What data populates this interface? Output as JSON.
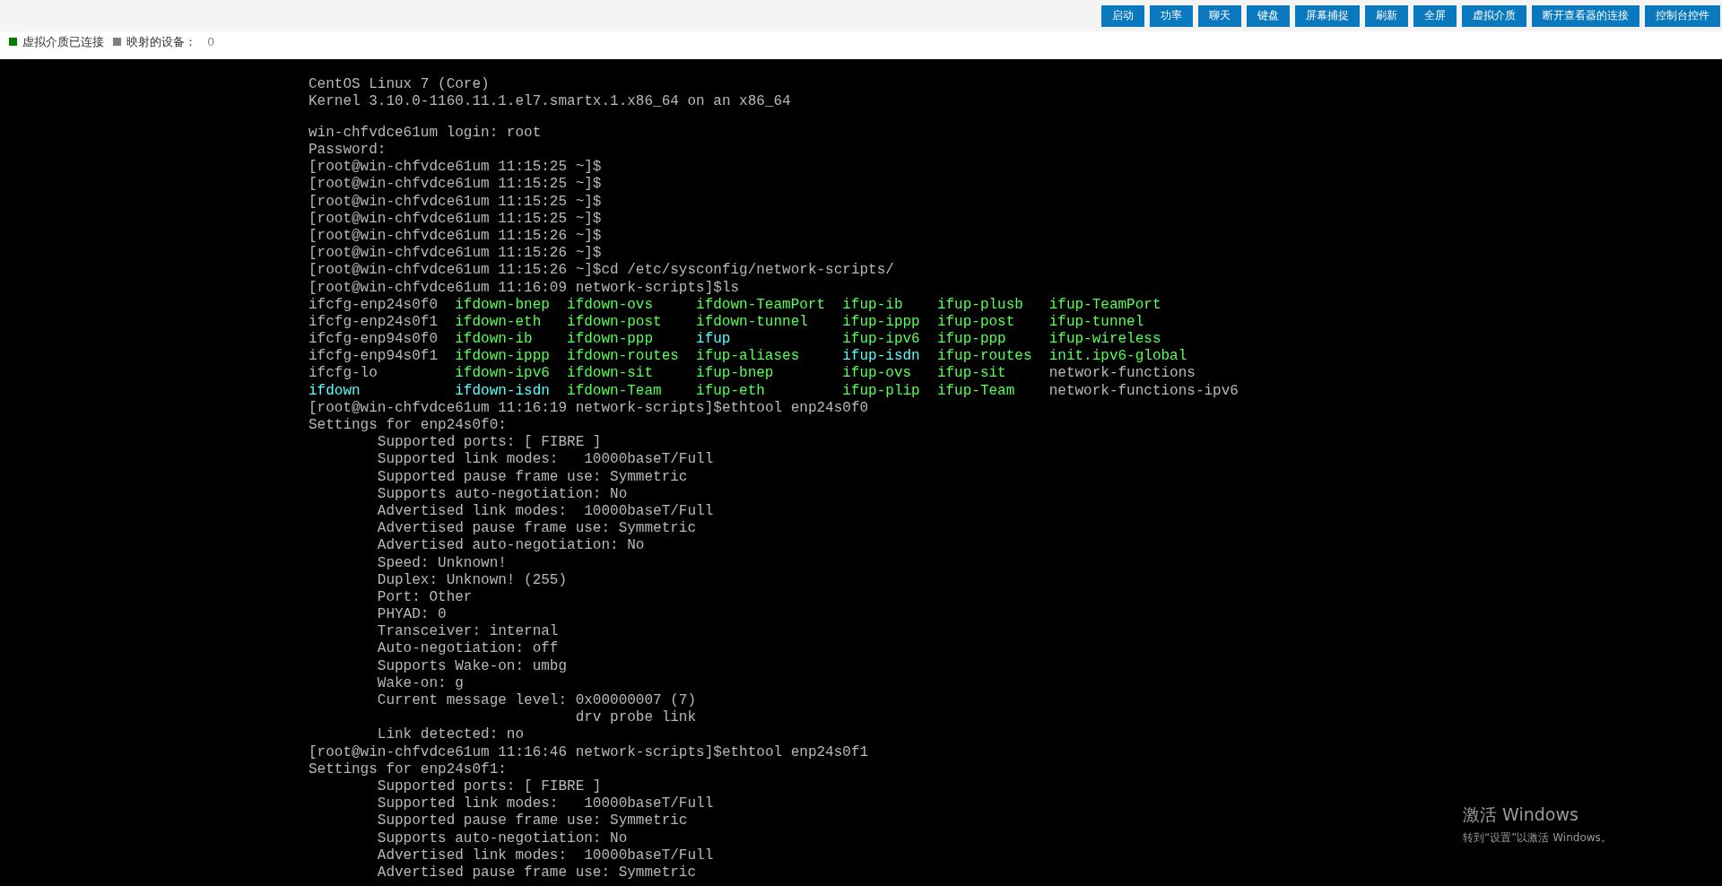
{
  "toolbar": {
    "buttons": [
      "启动",
      "功率",
      "聊天",
      "键盘",
      "屏幕捕捉",
      "刷新",
      "全屏",
      "虚拟介质",
      "断开查看器的连接",
      "控制台控件"
    ]
  },
  "status": [
    {
      "label": "虚拟介质已连接",
      "color": "#008000"
    },
    {
      "label": "映射的设备：",
      "color": "#808080",
      "value": "0"
    }
  ],
  "terminal": {
    "lines": [
      {
        "kind": "line",
        "text": "CentOS Linux 7 (Core)"
      },
      {
        "kind": "line",
        "text": "Kernel 3.10.0-1160.11.1.el7.smartx.1.x86_64 on an x86_64"
      },
      {
        "kind": "line",
        "gap_before": true,
        "text": "win-chfvdce61um login: root"
      },
      {
        "kind": "line",
        "text": "Password:"
      },
      {
        "kind": "line",
        "text": "[root@win-chfvdce61um 11:15:25 ~]$"
      },
      {
        "kind": "line",
        "text": "[root@win-chfvdce61um 11:15:25 ~]$"
      },
      {
        "kind": "line",
        "text": "[root@win-chfvdce61um 11:15:25 ~]$"
      },
      {
        "kind": "line",
        "text": "[root@win-chfvdce61um 11:15:25 ~]$"
      },
      {
        "kind": "line",
        "text": "[root@win-chfvdce61um 11:15:26 ~]$"
      },
      {
        "kind": "line",
        "text": "[root@win-chfvdce61um 11:15:26 ~]$"
      },
      {
        "kind": "line",
        "text": "[root@win-chfvdce61um 11:15:26 ~]$cd /etc/sysconfig/network-scripts/"
      },
      {
        "kind": "line",
        "text": "[root@win-chfvdce61um 11:16:09 network-scripts]$ls"
      },
      {
        "kind": "ls_row",
        "entries": [
          {
            "name": "ifcfg-enp24s0f0",
            "kind": "file"
          },
          {
            "name": "ifdown-bnep",
            "kind": "exec"
          },
          {
            "name": "ifdown-ovs",
            "kind": "exec"
          },
          {
            "name": "ifdown-TeamPort",
            "kind": "exec"
          },
          {
            "name": "ifup-ib",
            "kind": "exec"
          },
          {
            "name": "ifup-plusb",
            "kind": "exec"
          },
          {
            "name": "ifup-TeamPort",
            "kind": "exec"
          }
        ]
      },
      {
        "kind": "ls_row",
        "entries": [
          {
            "name": "ifcfg-enp24s0f1",
            "kind": "file"
          },
          {
            "name": "ifdown-eth",
            "kind": "exec"
          },
          {
            "name": "ifdown-post",
            "kind": "exec"
          },
          {
            "name": "ifdown-tunnel",
            "kind": "exec"
          },
          {
            "name": "ifup-ippp",
            "kind": "exec"
          },
          {
            "name": "ifup-post",
            "kind": "exec"
          },
          {
            "name": "ifup-tunnel",
            "kind": "exec"
          }
        ]
      },
      {
        "kind": "ls_row",
        "entries": [
          {
            "name": "ifcfg-enp94s0f0",
            "kind": "file"
          },
          {
            "name": "ifdown-ib",
            "kind": "exec"
          },
          {
            "name": "ifdown-ppp",
            "kind": "exec"
          },
          {
            "name": "ifup",
            "kind": "link"
          },
          {
            "name": "ifup-ipv6",
            "kind": "exec"
          },
          {
            "name": "ifup-ppp",
            "kind": "exec"
          },
          {
            "name": "ifup-wireless",
            "kind": "exec"
          }
        ]
      },
      {
        "kind": "ls_row",
        "entries": [
          {
            "name": "ifcfg-enp94s0f1",
            "kind": "file"
          },
          {
            "name": "ifdown-ippp",
            "kind": "exec"
          },
          {
            "name": "ifdown-routes",
            "kind": "exec"
          },
          {
            "name": "ifup-aliases",
            "kind": "exec"
          },
          {
            "name": "ifup-isdn",
            "kind": "link"
          },
          {
            "name": "ifup-routes",
            "kind": "exec"
          },
          {
            "name": "init.ipv6-global",
            "kind": "exec"
          }
        ]
      },
      {
        "kind": "ls_row",
        "entries": [
          {
            "name": "ifcfg-lo",
            "kind": "file"
          },
          {
            "name": "ifdown-ipv6",
            "kind": "exec"
          },
          {
            "name": "ifdown-sit",
            "kind": "exec"
          },
          {
            "name": "ifup-bnep",
            "kind": "exec"
          },
          {
            "name": "ifup-ovs",
            "kind": "exec"
          },
          {
            "name": "ifup-sit",
            "kind": "exec"
          },
          {
            "name": "network-functions",
            "kind": "file"
          }
        ]
      },
      {
        "kind": "ls_row",
        "entries": [
          {
            "name": "ifdown",
            "kind": "link"
          },
          {
            "name": "ifdown-isdn",
            "kind": "link"
          },
          {
            "name": "ifdown-Team",
            "kind": "exec"
          },
          {
            "name": "ifup-eth",
            "kind": "exec"
          },
          {
            "name": "ifup-plip",
            "kind": "exec"
          },
          {
            "name": "ifup-Team",
            "kind": "exec"
          },
          {
            "name": "network-functions-ipv6",
            "kind": "file"
          }
        ]
      },
      {
        "kind": "line",
        "text": "[root@win-chfvdce61um 11:16:19 network-scripts]$ethtool enp24s0f0"
      },
      {
        "kind": "line",
        "text": "Settings for enp24s0f0:"
      },
      {
        "kind": "detail",
        "text": "Supported ports: [ FIBRE ]"
      },
      {
        "kind": "detail",
        "text": "Supported link modes:   10000baseT/Full"
      },
      {
        "kind": "detail",
        "text": "Supported pause frame use: Symmetric"
      },
      {
        "kind": "detail",
        "text": "Supports auto-negotiation: No"
      },
      {
        "kind": "detail",
        "text": "Advertised link modes:  10000baseT/Full"
      },
      {
        "kind": "detail",
        "text": "Advertised pause frame use: Symmetric"
      },
      {
        "kind": "detail",
        "text": "Advertised auto-negotiation: No"
      },
      {
        "kind": "detail",
        "text": "Speed: Unknown!"
      },
      {
        "kind": "detail",
        "text": "Duplex: Unknown! (255)"
      },
      {
        "kind": "detail",
        "text": "Port: Other"
      },
      {
        "kind": "detail",
        "text": "PHYAD: 0"
      },
      {
        "kind": "detail",
        "text": "Transceiver: internal"
      },
      {
        "kind": "detail",
        "text": "Auto-negotiation: off"
      },
      {
        "kind": "detail",
        "text": "Supports Wake-on: umbg"
      },
      {
        "kind": "detail",
        "text": "Wake-on: g"
      },
      {
        "kind": "detail",
        "text": "Current message level: 0x00000007 (7)"
      },
      {
        "kind": "continuation",
        "text": "drv probe link"
      },
      {
        "kind": "detail",
        "text": "Link detected: no"
      },
      {
        "kind": "line",
        "text": "[root@win-chfvdce61um 11:16:46 network-scripts]$ethtool enp24s0f1"
      },
      {
        "kind": "line",
        "text": "Settings for enp24s0f1:"
      },
      {
        "kind": "detail",
        "text": "Supported ports: [ FIBRE ]"
      },
      {
        "kind": "detail",
        "text": "Supported link modes:   10000baseT/Full"
      },
      {
        "kind": "detail",
        "text": "Supported pause frame use: Symmetric"
      },
      {
        "kind": "detail",
        "text": "Supports auto-negotiation: No"
      },
      {
        "kind": "detail",
        "text": "Advertised link modes:  10000baseT/Full"
      },
      {
        "kind": "detail",
        "text": "Advertised pause frame use: Symmetric"
      }
    ]
  },
  "activation_notice": {
    "title": "激活 Windows",
    "text": "转到“设置”以激活 Windows。"
  }
}
